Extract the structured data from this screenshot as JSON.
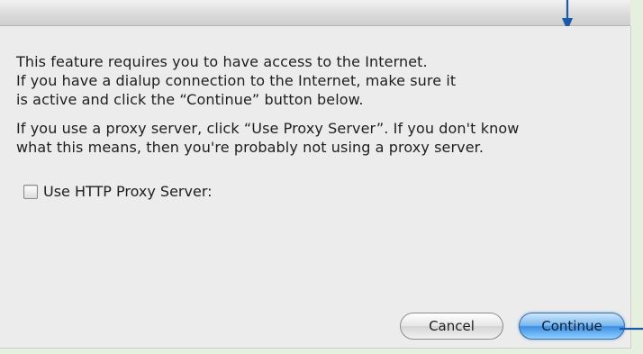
{
  "dialog": {
    "paragraph1": [
      "This feature requires you to have access to the Internet.",
      "If you have a dialup connection to the Internet, make sure it",
      "is active and click the “Continue” button below."
    ],
    "paragraph2": [
      "If you use a proxy server, click “Use Proxy Server”. If you don't know",
      "what this means, then you're probably not using a proxy server."
    ],
    "proxy_checkbox": {
      "label": "Use HTTP Proxy Server:",
      "checked": false
    },
    "buttons": {
      "cancel": "Cancel",
      "continue": "Continue"
    }
  },
  "colors": {
    "background": "#e6f0de",
    "dialog": "#ececec",
    "callout_arrow": "#1b5aa8",
    "default_button": "#4b9be6"
  },
  "icons": {
    "callout_top": "arrow-down-icon",
    "callout_right": "callout-line-icon"
  }
}
